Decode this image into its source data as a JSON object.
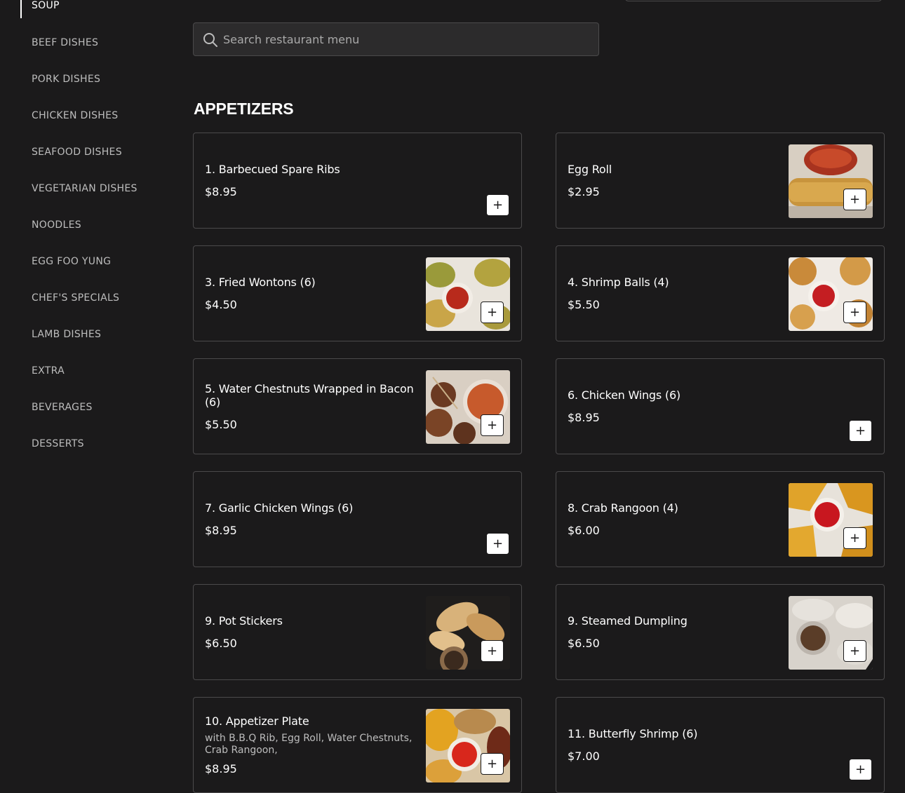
{
  "sidebar": {
    "items": [
      {
        "label": "SOUP",
        "active": true
      },
      {
        "label": "BEEF DISHES"
      },
      {
        "label": "PORK DISHES"
      },
      {
        "label": "CHICKEN DISHES"
      },
      {
        "label": "SEAFOOD DISHES"
      },
      {
        "label": "VEGETARIAN DISHES"
      },
      {
        "label": "NOODLES"
      },
      {
        "label": "EGG FOO YUNG"
      },
      {
        "label": "CHEF'S SPECIALS"
      },
      {
        "label": "LAMB DISHES"
      },
      {
        "label": "EXTRA"
      },
      {
        "label": "BEVERAGES"
      },
      {
        "label": "DESSERTS"
      }
    ]
  },
  "search": {
    "placeholder": "Search restaurant menu",
    "icon": "search-icon"
  },
  "section": {
    "title": "APPETIZERS"
  },
  "colors": {
    "background": "#1b1a1b",
    "card_border": "#4b4a4b",
    "text": "#ffffff",
    "muted_text": "#bdbdbd"
  },
  "items": [
    {
      "name": "1. Barbecued Spare Ribs",
      "price": "$8.95",
      "image": false,
      "add_label": "+"
    },
    {
      "name": "Egg Roll",
      "price": "$2.95",
      "image": true,
      "add_label": "+"
    },
    {
      "name": "3. Fried Wontons (6)",
      "price": "$4.50",
      "image": true,
      "add_label": "+"
    },
    {
      "name": "4. Shrimp Balls (4)",
      "price": "$5.50",
      "image": true,
      "add_label": "+"
    },
    {
      "name": "5. Water Chestnuts Wrapped in Bacon (6)",
      "price": "$5.50",
      "image": true,
      "add_label": "+"
    },
    {
      "name": "6. Chicken Wings (6)",
      "price": "$8.95",
      "image": false,
      "add_label": "+"
    },
    {
      "name": "7. Garlic Chicken Wings (6)",
      "price": "$8.95",
      "image": false,
      "add_label": "+"
    },
    {
      "name": "8. Crab Rangoon (4)",
      "price": "$6.00",
      "image": true,
      "add_label": "+"
    },
    {
      "name": "9. Pot Stickers",
      "price": "$6.50",
      "image": true,
      "add_label": "+"
    },
    {
      "name": "9. Steamed Dumpling",
      "price": "$6.50",
      "image": true,
      "add_label": "+"
    },
    {
      "name": "10. Appetizer Plate",
      "description": "with B.B.Q Rib, Egg Roll, Water Chestnuts, Crab Rangoon,",
      "price": "$8.95",
      "image": true,
      "add_label": "+"
    },
    {
      "name": "11. Butterfly Shrimp (6)",
      "price": "$7.00",
      "image": false,
      "add_label": "+"
    }
  ]
}
